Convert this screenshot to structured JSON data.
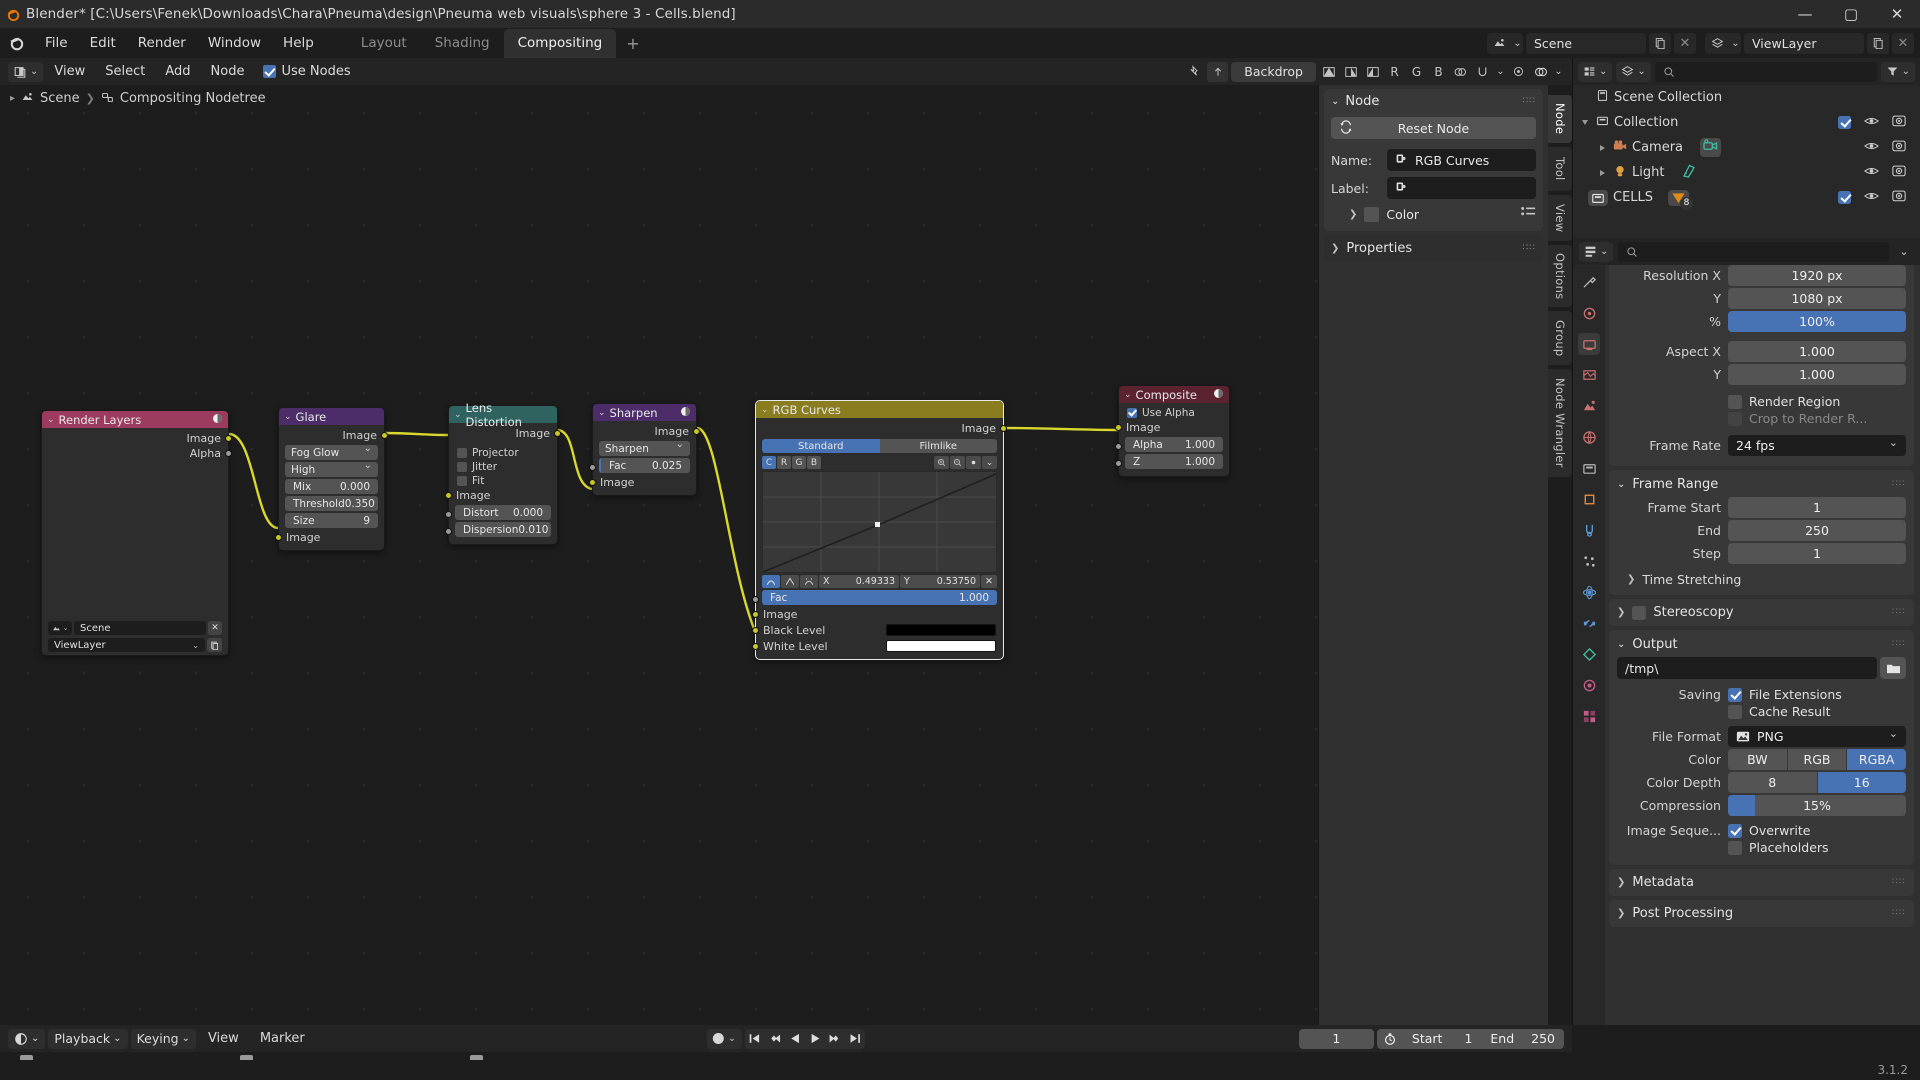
{
  "window": {
    "title": "Blender* [C:\\Users\\Fenek\\Downloads\\Chara\\Pneuma\\design\\Pneuma web visuals\\sphere 3 - Cells.blend]",
    "minimize": "—",
    "maximize": "▢",
    "close": "✕"
  },
  "topbar": {
    "menus": [
      "File",
      "Edit",
      "Render",
      "Window",
      "Help"
    ],
    "workspaces": [
      {
        "label": "Layout",
        "active": false
      },
      {
        "label": "Shading",
        "active": false
      },
      {
        "label": "Compositing",
        "active": true
      }
    ],
    "add_workspace": "+",
    "scene_name": "Scene",
    "viewlayer_name": "ViewLayer"
  },
  "node_editor": {
    "menus": [
      "View",
      "Select",
      "Add",
      "Node"
    ],
    "use_nodes_label": "Use Nodes",
    "use_nodes_checked": true,
    "backdrop_label": "Backdrop",
    "channel_buttons": [
      "R",
      "G",
      "B"
    ],
    "breadcrumb": [
      "Scene",
      "Compositing Nodetree"
    ]
  },
  "nodes": {
    "render_layers": {
      "title": "Render Layers",
      "outputs": [
        "Image",
        "Alpha"
      ],
      "scene": "Scene",
      "view_layer": "ViewLayer",
      "header_color": "#9c3b5e"
    },
    "glare": {
      "title": "Glare",
      "output": "Image",
      "glare_type": "Fog Glow",
      "quality": "High",
      "fields": [
        {
          "label": "Mix",
          "value": "0.000"
        },
        {
          "label": "Threshold",
          "value": "0.350"
        },
        {
          "label": "Size",
          "value": "9"
        }
      ],
      "input": "Image",
      "header_color": "#4c2c69"
    },
    "lens_distortion": {
      "title": "Lens Distortion",
      "output": "Image",
      "checkboxes": [
        {
          "label": "Projector",
          "checked": false
        },
        {
          "label": "Jitter",
          "checked": false
        },
        {
          "label": "Fit",
          "checked": false
        }
      ],
      "input": "Image",
      "fields": [
        {
          "label": "Distort",
          "value": "0.000"
        },
        {
          "label": "Dispersion",
          "value": "0.010"
        }
      ],
      "header_color": "#2e6360"
    },
    "sharpen": {
      "title": "Sharpen",
      "output": "Image",
      "filter_type": "Sharpen",
      "fac_label": "Fac",
      "fac_value": "0.025",
      "input": "Image",
      "header_color": "#4c2c69"
    },
    "rgb_curves": {
      "title": "RGB Curves",
      "output": "Image",
      "tone_modes": [
        {
          "label": "Standard",
          "active": true
        },
        {
          "label": "Filmlike",
          "active": false
        }
      ],
      "channels": [
        {
          "label": "C",
          "active": true
        },
        {
          "label": "R",
          "active": false
        },
        {
          "label": "G",
          "active": false
        },
        {
          "label": "B",
          "active": false
        }
      ],
      "tool_icons": [
        "zoom-in-icon",
        "zoom-out-icon",
        "point-icon",
        "chevron-down-icon"
      ],
      "handle_icons": [
        "auto-clamped-handle-icon",
        "vector-handle-icon",
        "auto-handle-icon"
      ],
      "x_label": "X",
      "x_value": "0.49333",
      "y_label": "Y",
      "y_value": "0.53750",
      "delete_point": "✕",
      "fac_label": "Fac",
      "fac_value": "1.000",
      "input_image": "Image",
      "black_level_label": "Black Level",
      "black_level_color": "#000000",
      "white_level_label": "White Level",
      "white_level_color": "#ffffff",
      "header_color": "#8a7d1f"
    },
    "composite": {
      "title": "Composite",
      "use_alpha_label": "Use Alpha",
      "use_alpha_checked": true,
      "input_image": "Image",
      "fields": [
        {
          "label": "Alpha",
          "value": "1.000"
        },
        {
          "label": "Z",
          "value": "1.000"
        }
      ],
      "header_color": "#5b2330"
    }
  },
  "npanel": {
    "vertical_tabs": [
      {
        "label": "Node",
        "active": true
      },
      {
        "label": "Tool",
        "active": false
      },
      {
        "label": "View",
        "active": false
      },
      {
        "label": "Options",
        "active": false
      },
      {
        "label": "Group",
        "active": false
      },
      {
        "label": "Node Wrangler",
        "active": false
      }
    ],
    "node_section_title": "Node",
    "reset_node_label": "Reset Node",
    "name_label": "Name:",
    "name_value": "RGB Curves",
    "label_label": "Label:",
    "label_value": "",
    "color_label": "Color",
    "properties_label": "Properties"
  },
  "outliner": {
    "display_mode": "view-layer-icon",
    "search_placeholder": "",
    "rows": [
      {
        "label": "Scene Collection",
        "indent": 0,
        "icon": "scene-collection-icon",
        "expand": "",
        "checkbox": false,
        "eye": false,
        "camera": false
      },
      {
        "label": "Collection",
        "indent": 1,
        "icon": "collection-icon",
        "expand": "down",
        "checkbox": true,
        "eye": true,
        "camera": true
      },
      {
        "label": "Camera",
        "indent": 2,
        "icon": "camera-object-icon",
        "expand": "right",
        "checkbox": false,
        "eye": true,
        "camera": true,
        "badge": "camera-data-icon"
      },
      {
        "label": "Light",
        "indent": 2,
        "icon": "light-object-icon",
        "expand": "right",
        "checkbox": false,
        "eye": true,
        "camera": true,
        "badge": "light-data-icon"
      },
      {
        "label": "CELLS",
        "indent": 0,
        "icon": "collection-icon",
        "expand": "",
        "checkbox": true,
        "eye": true,
        "camera": true,
        "badge": "mesh-count-icon",
        "badge_count": "8"
      }
    ]
  },
  "properties": {
    "tabs": [
      "tool-icon",
      "render-icon",
      "output-icon",
      "view-layer-icon",
      "scene-icon",
      "world-icon",
      "collection-icon",
      "object-icon",
      "modifier-icon",
      "particles-icon",
      "physics-icon",
      "constraints-icon",
      "data-icon",
      "material-icon",
      "texture-icon"
    ],
    "active_tab_index": 2,
    "format": {
      "rows": [
        {
          "label": "Resolution X",
          "value": "1920 px",
          "style": "plain"
        },
        {
          "label": "Y",
          "value": "1080 px",
          "style": "plain"
        },
        {
          "label": "%",
          "value": "100%",
          "style": "blue"
        },
        {
          "label": "Aspect X",
          "value": "1.000",
          "style": "plain"
        },
        {
          "label": "Y",
          "value": "1.000",
          "style": "plain"
        }
      ],
      "render_region_label": "Render Region",
      "render_region_checked": false,
      "crop_label": "Crop to Render R...",
      "crop_checked": false,
      "frame_rate_label": "Frame Rate",
      "frame_rate_value": "24 fps"
    },
    "frame_range": {
      "title": "Frame Range",
      "rows": [
        {
          "label": "Frame Start",
          "value": "1"
        },
        {
          "label": "End",
          "value": "250"
        },
        {
          "label": "Step",
          "value": "1"
        }
      ],
      "time_stretching": "Time Stretching"
    },
    "stereoscopy": {
      "title": "Stereoscopy",
      "checked": false
    },
    "output": {
      "title": "Output",
      "path": "/tmp\\",
      "folder_icon": "folder-icon",
      "saving_label": "Saving",
      "file_extensions_label": "File Extensions",
      "file_extensions_checked": true,
      "cache_result_label": "Cache Result",
      "cache_result_checked": false,
      "file_format_label": "File Format",
      "file_format_value": "PNG",
      "color_label": "Color",
      "color_options": [
        {
          "label": "BW",
          "active": false
        },
        {
          "label": "RGB",
          "active": false
        },
        {
          "label": "RGBA",
          "active": true
        }
      ],
      "color_depth_label": "Color Depth",
      "color_depth_options": [
        {
          "label": "8",
          "active": false
        },
        {
          "label": "16",
          "active": true
        }
      ],
      "compression_label": "Compression",
      "compression_value": "15%",
      "compression_percent": 15,
      "image_sequence_label": "Image Seque...",
      "overwrite_label": "Overwrite",
      "overwrite_checked": true,
      "placeholders_label": "Placeholders",
      "placeholders_checked": false
    },
    "metadata": {
      "title": "Metadata"
    },
    "post_processing": {
      "title": "Post Processing"
    }
  },
  "timeline": {
    "editor_icon": "timeline-icon",
    "menus": [
      "Playback",
      "Keying",
      "View",
      "Marker"
    ],
    "playback_label": "Playback",
    "keying_label": "Keying",
    "nav_buttons": [
      "jump-start-icon",
      "prev-keyframe-icon",
      "play-reverse-icon",
      "play-icon",
      "next-keyframe-icon",
      "jump-end-icon"
    ],
    "current_frame": "1",
    "start_label": "Start",
    "start_value": "1",
    "end_label": "End",
    "end_value": "250"
  },
  "statusbar": {
    "version": "3.1.2"
  },
  "colors": {
    "accent_blue": "#4772b3",
    "noodle_yellow": "#d8d82f",
    "background": "#1d1d1d"
  }
}
